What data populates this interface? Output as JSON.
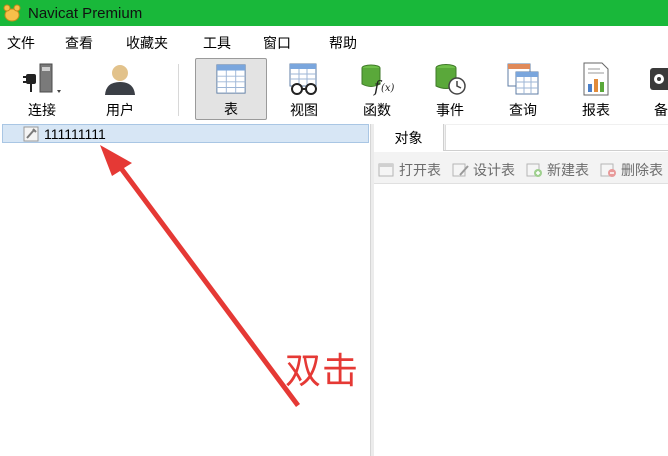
{
  "window": {
    "title": "Navicat Premium"
  },
  "menu": [
    "文件",
    "查看",
    "收藏夹",
    "工具",
    "窗口",
    "帮助"
  ],
  "toolbar": {
    "connect": "连接",
    "user": "用户",
    "table": "表",
    "view": "视图",
    "function": "函数",
    "event": "事件",
    "query": "查询",
    "report": "报表",
    "backup": "备"
  },
  "tree": {
    "connection_name": "111111111"
  },
  "tabs": {
    "objects": "对象"
  },
  "object_toolbar": {
    "open_table": "打开表",
    "design_table": "设计表",
    "new_table": "新建表",
    "delete_table": "删除表"
  },
  "annotation": {
    "text": "双击",
    "color": "#e53935"
  },
  "colors": {
    "titlebar": "#19b83a",
    "selection": "#d7e6f5"
  }
}
